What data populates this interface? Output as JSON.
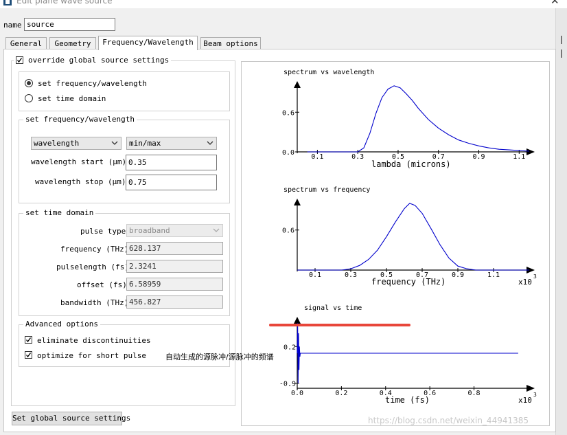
{
  "window": {
    "title": "Edit plane wave source",
    "close_glyph": "✕"
  },
  "name_field": {
    "label": "name",
    "value": "source"
  },
  "tabs": [
    {
      "label": "General"
    },
    {
      "label": "Geometry"
    },
    {
      "label": "Frequency/Wavelength",
      "active": true
    },
    {
      "label": "Beam options"
    }
  ],
  "override": {
    "label": "override global source settings",
    "checked": true
  },
  "mode_group": {
    "options": [
      {
        "label": "set frequency/wavelength",
        "selected": true
      },
      {
        "label": "set time domain",
        "selected": false
      }
    ]
  },
  "freq_group": {
    "title": "set frequency/wavelength",
    "type_select": "wavelength",
    "range_select": "min/max",
    "start": {
      "label": "wavelength start (μm)",
      "value": "0.35"
    },
    "stop": {
      "label": "wavelength stop (μm)",
      "value": "0.75"
    }
  },
  "time_group": {
    "title": "set time domain",
    "pulse_type": {
      "label": "pulse type",
      "value": "broadband"
    },
    "frequency": {
      "label": "frequency (THz)",
      "value": "628.137"
    },
    "pulselength": {
      "label": "pulselength (fs)",
      "value": "2.3241"
    },
    "offset": {
      "label": "offset (fs)",
      "value": "6.58959"
    },
    "bandwidth": {
      "label": "bandwidth (THz)",
      "value": "456.827"
    }
  },
  "advanced": {
    "title": "Advanced options",
    "eliminate": {
      "label": "eliminate discontinuities",
      "checked": true
    },
    "optimize": {
      "label": "optimize for short pulse",
      "checked": true
    }
  },
  "global_button": {
    "label": "Set global source settings"
  },
  "annotation": "自动生成的源脉冲/源脉冲的频谱",
  "watermark": "https://blog.csdn.net/weixin_44941385",
  "colors": {
    "curve": "#0000cc",
    "axis": "#000000",
    "annotation_line": "#e8463a"
  },
  "chart_data": [
    {
      "type": "line",
      "title": "spectrum vs wavelength",
      "xlabel": "lambda (microns)",
      "x_ticks": [
        "0.1",
        "0.3",
        "0.5",
        "0.7",
        "0.9",
        "1.1"
      ],
      "y_ticks": [
        "0.6",
        "0.0"
      ],
      "xlim": [
        0.0,
        1.15
      ],
      "ylim": [
        0.0,
        1.05
      ],
      "series": [
        {
          "x": [
            0.05,
            0.3,
            0.33,
            0.36,
            0.39,
            0.42,
            0.45,
            0.48,
            0.51,
            0.54,
            0.57,
            0.6,
            0.65,
            0.7,
            0.75,
            0.8,
            0.85,
            0.9,
            0.95,
            1.0,
            1.05,
            1.1,
            1.15
          ],
          "y": [
            0.0,
            0.0,
            0.06,
            0.28,
            0.58,
            0.82,
            0.95,
            1.0,
            0.97,
            0.88,
            0.78,
            0.66,
            0.49,
            0.36,
            0.26,
            0.18,
            0.13,
            0.09,
            0.06,
            0.04,
            0.03,
            0.02,
            0.01
          ]
        }
      ]
    },
    {
      "type": "line",
      "title": "spectrum vs frequency",
      "xlabel": "frequency (THz)",
      "x_multiplier": "x10^3",
      "x_ticks": [
        "0.1",
        "0.3",
        "0.5",
        "0.7",
        "0.9",
        "1.1"
      ],
      "y_ticks": [
        "0.6"
      ],
      "xlim": [
        0.0,
        1.3
      ],
      "ylim": [
        0.0,
        1.05
      ],
      "series": [
        {
          "x": [
            0.0,
            0.25,
            0.3,
            0.35,
            0.4,
            0.45,
            0.5,
            0.55,
            0.6,
            0.63,
            0.66,
            0.7,
            0.75,
            0.8,
            0.85,
            0.9,
            0.95,
            1.0,
            1.3
          ],
          "y": [
            0.0,
            0.0,
            0.02,
            0.07,
            0.16,
            0.3,
            0.5,
            0.72,
            0.92,
            1.0,
            0.97,
            0.85,
            0.62,
            0.38,
            0.18,
            0.06,
            0.02,
            0.0,
            0.0
          ]
        }
      ]
    },
    {
      "type": "line",
      "title": "signal vs time",
      "xlabel": "time (fs)",
      "x_multiplier": "x10^3",
      "x_ticks": [
        "0.0",
        "0.2",
        "0.4",
        "0.6",
        "0.8"
      ],
      "y_ticks": [
        "0.2",
        "-0.9"
      ],
      "xlim": [
        0.0,
        1.05
      ],
      "ylim": [
        -1.05,
        1.05
      ],
      "series": [
        {
          "x": [
            0.0,
            0.002,
            0.004,
            0.006,
            0.008,
            0.01,
            0.012,
            0.014,
            1.0
          ],
          "y": [
            0.0,
            0.9,
            -0.9,
            0.6,
            -0.5,
            0.2,
            -0.1,
            0.0,
            0.0
          ]
        }
      ]
    }
  ]
}
